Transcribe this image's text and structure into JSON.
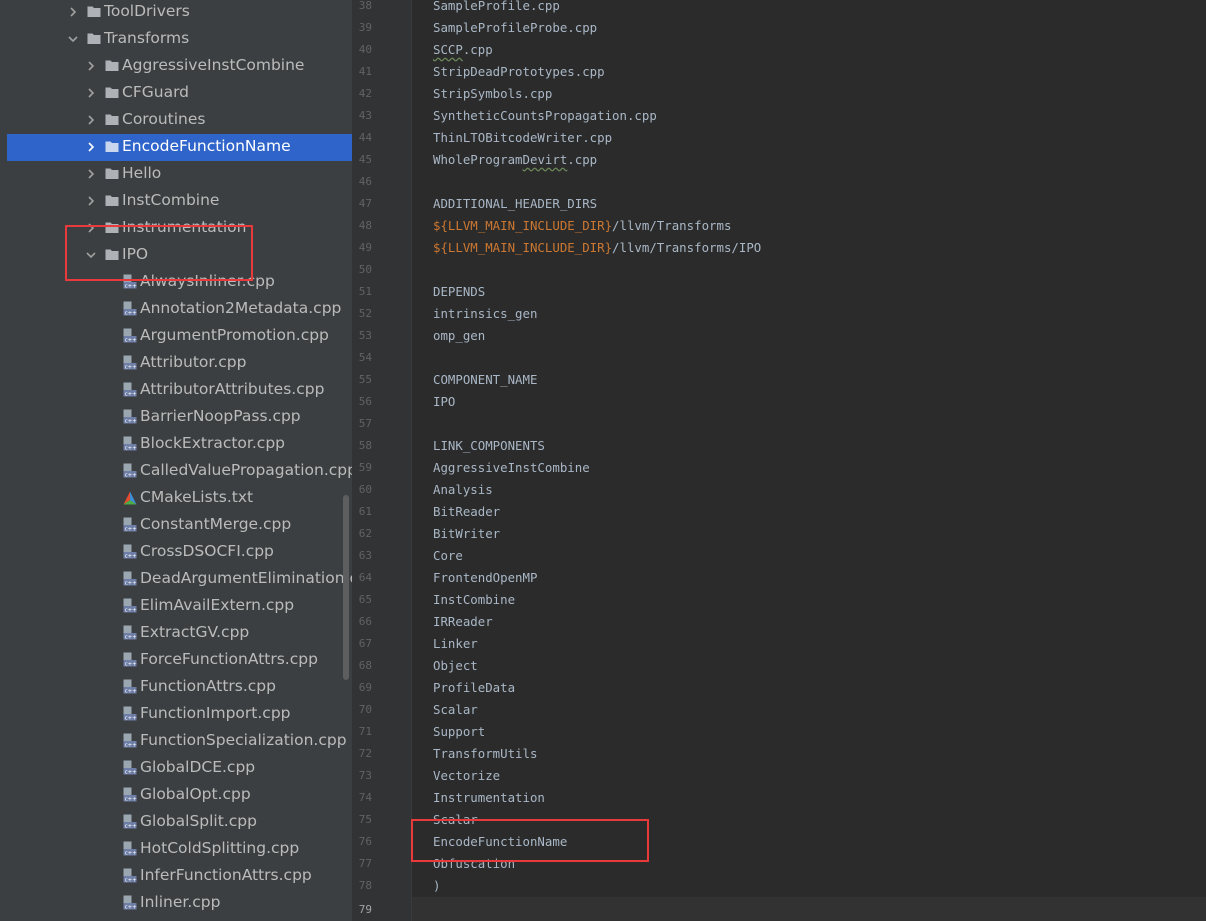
{
  "tree": {
    "rows": [
      {
        "label": "ToolDrivers",
        "kind": "folder",
        "level": 1,
        "state": "collapsed"
      },
      {
        "label": "Transforms",
        "kind": "folder",
        "level": 1,
        "state": "expanded"
      },
      {
        "label": "AggressiveInstCombine",
        "kind": "folder",
        "level": 2,
        "state": "collapsed"
      },
      {
        "label": "CFGuard",
        "kind": "folder",
        "level": 2,
        "state": "collapsed"
      },
      {
        "label": "Coroutines",
        "kind": "folder",
        "level": 2,
        "state": "collapsed"
      },
      {
        "label": "EncodeFunctionName",
        "kind": "folder",
        "level": 2,
        "state": "collapsed",
        "selected": true
      },
      {
        "label": "Hello",
        "kind": "folder",
        "level": 2,
        "state": "collapsed"
      },
      {
        "label": "InstCombine",
        "kind": "folder",
        "level": 2,
        "state": "collapsed"
      },
      {
        "label": "Instrumentation",
        "kind": "folder",
        "level": 2,
        "state": "collapsed"
      },
      {
        "label": "IPO",
        "kind": "folder",
        "level": 2,
        "state": "expanded"
      },
      {
        "label": "AlwaysInliner.cpp",
        "kind": "cpp",
        "level": 3
      },
      {
        "label": "Annotation2Metadata.cpp",
        "kind": "cpp",
        "level": 3
      },
      {
        "label": "ArgumentPromotion.cpp",
        "kind": "cpp",
        "level": 3
      },
      {
        "label": "Attributor.cpp",
        "kind": "cpp",
        "level": 3
      },
      {
        "label": "AttributorAttributes.cpp",
        "kind": "cpp",
        "level": 3
      },
      {
        "label": "BarrierNoopPass.cpp",
        "kind": "cpp",
        "level": 3
      },
      {
        "label": "BlockExtractor.cpp",
        "kind": "cpp",
        "level": 3
      },
      {
        "label": "CalledValuePropagation.cpp",
        "kind": "cpp",
        "level": 3
      },
      {
        "label": "CMakeLists.txt",
        "kind": "cmake",
        "level": 3
      },
      {
        "label": "ConstantMerge.cpp",
        "kind": "cpp",
        "level": 3
      },
      {
        "label": "CrossDSOCFI.cpp",
        "kind": "cpp",
        "level": 3
      },
      {
        "label": "DeadArgumentElimination.cpp",
        "kind": "cpp",
        "level": 3
      },
      {
        "label": "ElimAvailExtern.cpp",
        "kind": "cpp",
        "level": 3
      },
      {
        "label": "ExtractGV.cpp",
        "kind": "cpp",
        "level": 3
      },
      {
        "label": "ForceFunctionAttrs.cpp",
        "kind": "cpp",
        "level": 3
      },
      {
        "label": "FunctionAttrs.cpp",
        "kind": "cpp",
        "level": 3
      },
      {
        "label": "FunctionImport.cpp",
        "kind": "cpp",
        "level": 3
      },
      {
        "label": "FunctionSpecialization.cpp",
        "kind": "cpp",
        "level": 3
      },
      {
        "label": "GlobalDCE.cpp",
        "kind": "cpp",
        "level": 3
      },
      {
        "label": "GlobalOpt.cpp",
        "kind": "cpp",
        "level": 3
      },
      {
        "label": "GlobalSplit.cpp",
        "kind": "cpp",
        "level": 3
      },
      {
        "label": "HotColdSplitting.cpp",
        "kind": "cpp",
        "level": 3
      },
      {
        "label": "InferFunctionAttrs.cpp",
        "kind": "cpp",
        "level": 3
      },
      {
        "label": "Inliner.cpp",
        "kind": "cpp",
        "level": 3
      }
    ]
  },
  "editor": {
    "current_line": "79",
    "lines": [
      {
        "n": "38",
        "text": "SampleProfile.cpp"
      },
      {
        "n": "39",
        "text": "SampleProfileProbe.cpp"
      },
      {
        "n": "40",
        "text": "SCCP.cpp",
        "wavy": "SCCP"
      },
      {
        "n": "41",
        "text": "StripDeadPrototypes.cpp"
      },
      {
        "n": "42",
        "text": "StripSymbols.cpp"
      },
      {
        "n": "43",
        "text": "SyntheticCountsPropagation.cpp"
      },
      {
        "n": "44",
        "text": "ThinLTOBitcodeWriter.cpp"
      },
      {
        "n": "45",
        "text": "WholeProgramDevirt.cpp",
        "wavy": "Devirt"
      },
      {
        "n": "46",
        "text": ""
      },
      {
        "n": "47",
        "text": "ADDITIONAL_HEADER_DIRS"
      },
      {
        "n": "48",
        "text": "${LLVM_MAIN_INCLUDE_DIR}/llvm/Transforms",
        "macro": "${LLVM_MAIN_INCLUDE_DIR}"
      },
      {
        "n": "49",
        "text": "${LLVM_MAIN_INCLUDE_DIR}/llvm/Transforms/IPO",
        "macro": "${LLVM_MAIN_INCLUDE_DIR}"
      },
      {
        "n": "50",
        "text": ""
      },
      {
        "n": "51",
        "text": "DEPENDS"
      },
      {
        "n": "52",
        "text": "intrinsics_gen"
      },
      {
        "n": "53",
        "text": "omp_gen"
      },
      {
        "n": "54",
        "text": ""
      },
      {
        "n": "55",
        "text": "COMPONENT_NAME"
      },
      {
        "n": "56",
        "text": "IPO"
      },
      {
        "n": "57",
        "text": ""
      },
      {
        "n": "58",
        "text": "LINK_COMPONENTS"
      },
      {
        "n": "59",
        "text": "AggressiveInstCombine"
      },
      {
        "n": "60",
        "text": "Analysis"
      },
      {
        "n": "61",
        "text": "BitReader"
      },
      {
        "n": "62",
        "text": "BitWriter"
      },
      {
        "n": "63",
        "text": "Core"
      },
      {
        "n": "64",
        "text": "FrontendOpenMP"
      },
      {
        "n": "65",
        "text": "InstCombine"
      },
      {
        "n": "66",
        "text": "IRReader"
      },
      {
        "n": "67",
        "text": "Linker"
      },
      {
        "n": "68",
        "text": "Object"
      },
      {
        "n": "69",
        "text": "ProfileData"
      },
      {
        "n": "70",
        "text": "Scalar"
      },
      {
        "n": "71",
        "text": "Support"
      },
      {
        "n": "72",
        "text": "TransformUtils"
      },
      {
        "n": "73",
        "text": "Vectorize"
      },
      {
        "n": "74",
        "text": "Instrumentation"
      },
      {
        "n": "75",
        "text": "Scalar"
      },
      {
        "n": "76",
        "text": "EncodeFunctionName"
      },
      {
        "n": "77",
        "text": "Obfuscation"
      },
      {
        "n": "78",
        "text": ")"
      },
      {
        "n": "79",
        "text": ""
      }
    ]
  },
  "colors": {
    "selection": "#2f65ca",
    "annotation_box": "#e8393b",
    "macro": "#cc7832"
  }
}
